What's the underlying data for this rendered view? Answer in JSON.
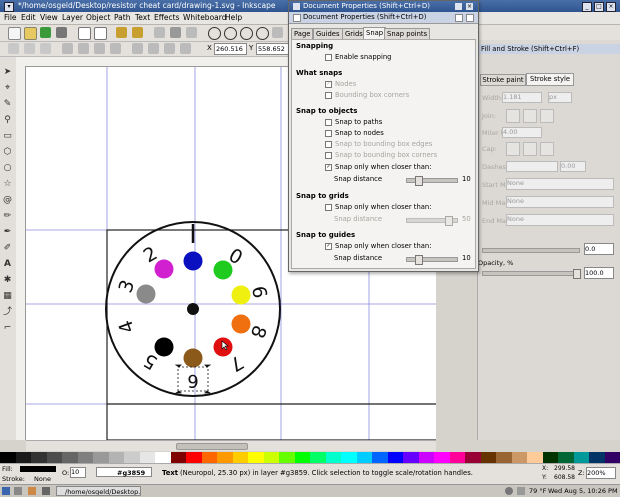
{
  "window": {
    "title": "*/home/osgeld/Desktop/resistor cheat card/drawing-1.svg - Inkscape"
  },
  "menu": [
    "File",
    "Edit",
    "View",
    "Layer",
    "Object",
    "Path",
    "Text",
    "Effects",
    "Whiteboard",
    "Help"
  ],
  "toolbar": {
    "x_label": "X",
    "x_value": "260.516",
    "y_label": "Y",
    "y_value": "558.652"
  },
  "dialog": {
    "title": "Document Properties (Shift+Ctrl+D)",
    "subtitle": "Document Properties (Shift+Ctrl+D)",
    "tabs": [
      "Page",
      "Guides",
      "Grids",
      "Snap",
      "Snap points"
    ],
    "active_tab": "Snap",
    "snapping_heading": "Snapping",
    "enable_snapping": "Enable snapping",
    "what_snaps_heading": "What snaps",
    "nodes": "Nodes",
    "bbox_corners": "Bounding box corners",
    "snap_objects_heading": "Snap to objects",
    "snap_paths": "Snap to paths",
    "snap_nodes": "Snap to nodes",
    "snap_bbox_edges": "Snap to bounding box edges",
    "snap_bbox_corners": "Snap to bounding box corners",
    "snap_only_closer": "Snap only when closer than:",
    "snap_distance": "Snap distance",
    "obj_distance_value": "10",
    "snap_grids_heading": "Snap to grids",
    "grid_only_closer": "Snap only when closer than:",
    "grid_distance": "Snap distance",
    "grid_distance_value": "50",
    "snap_guides_heading": "Snap to guides",
    "guide_only_closer": "Snap only when closer than:",
    "guide_distance": "Snap distance",
    "guide_distance_value": "10"
  },
  "fill_stroke": {
    "title": "Fill and Stroke (Shift+Ctrl+F)",
    "tab_stroke_paint": "Stroke paint",
    "tab_stroke_style": "Stroke style",
    "width_label": "Width:",
    "width_value": "1.181",
    "width_unit": "px",
    "join_label": "Join:",
    "miter_label": "Miter limit:",
    "miter_value": "4.00",
    "cap_label": "Cap:",
    "dashes_label": "Dashes:",
    "dashes_value": "0.00",
    "start_markers": "Start Markers:",
    "mid_markers": "Mid Markers:",
    "end_markers": "End Markers:",
    "none": "None",
    "blur_value": "0.0",
    "opacity_label": "Opacity, %",
    "opacity_value": "100.0"
  },
  "dial": {
    "digits": [
      "1",
      "0",
      "6",
      "8",
      "7",
      "6",
      "5",
      "4",
      "3",
      "2"
    ]
  },
  "status": {
    "fill_label": "Fill:",
    "stroke_label": "Stroke:",
    "stroke_value": "None",
    "opacity_label": "O:",
    "opacity_value": "10",
    "layer_id": "#g3859",
    "message_bold": "Text",
    "message": "(Neuropol, 25.30 px) in layer #g3859. Click selection to toggle scale/rotation handles.",
    "x_label": "X:",
    "x_value": "299.58",
    "y_label": "Y:",
    "y_value": "608.58",
    "z_label": "Z:",
    "zoom_value": "200%"
  },
  "taskbar": {
    "window_label": "/home/osgeld/Desktop...",
    "temperature": "79 °F",
    "datetime": "Wed Aug 5, 10:26 PM"
  },
  "palette": [
    "#000000",
    "#1a1a1a",
    "#333333",
    "#4d4d4d",
    "#666666",
    "#808080",
    "#999999",
    "#b3b3b3",
    "#cccccc",
    "#e6e6e6",
    "#ffffff",
    "#800000",
    "#ff0000",
    "#ff6600",
    "#ff9900",
    "#ffcc00",
    "#ffff00",
    "#ccff00",
    "#66ff00",
    "#00ff00",
    "#00ff66",
    "#00ffcc",
    "#00ffff",
    "#00ccff",
    "#0066ff",
    "#0000ff",
    "#6600ff",
    "#cc00ff",
    "#ff00ff",
    "#ff0099",
    "#990033",
    "#663300",
    "#996633",
    "#cc9966",
    "#ffcc99",
    "#003300",
    "#006633",
    "#009999",
    "#003366",
    "#330066"
  ],
  "dots": [
    {
      "name": "blue-dot",
      "color": "#0a10c0"
    },
    {
      "name": "green-dot",
      "color": "#1ecb1e"
    },
    {
      "name": "yellow-dot",
      "color": "#f0f010"
    },
    {
      "name": "orange-dot",
      "color": "#f07010"
    },
    {
      "name": "red-dot",
      "color": "#e01010"
    },
    {
      "name": "brown-dot",
      "color": "#8b5a1a"
    },
    {
      "name": "black-dot",
      "color": "#000000"
    },
    {
      "name": "grey-dot",
      "color": "#8a8a8a"
    },
    {
      "name": "violet-dot",
      "color": "#d020d0"
    }
  ]
}
